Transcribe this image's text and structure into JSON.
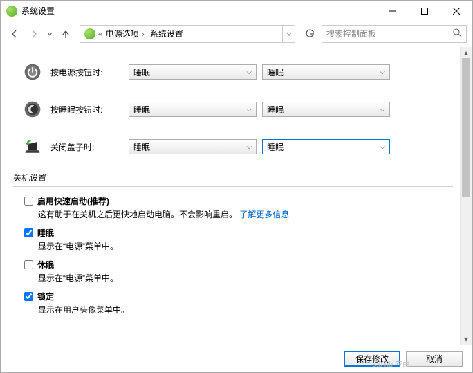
{
  "window": {
    "title": "系统设置"
  },
  "breadcrumb": {
    "sep": "«",
    "items": [
      "电源选项",
      "系统设置"
    ]
  },
  "search": {
    "placeholder": "搜索控制面板"
  },
  "rows": {
    "power_button": {
      "label": "按电源按钮时:",
      "val1": "睡眠",
      "val2": "睡眠"
    },
    "sleep_button": {
      "label": "按睡眠按钮时:",
      "val1": "睡眠",
      "val2": "睡眠"
    },
    "close_lid": {
      "label": "关闭盖子时:",
      "val1": "睡眠",
      "val2": "睡眠"
    }
  },
  "shutdown": {
    "section": "关机设置",
    "fast_start": {
      "label": "启用快速启动(推荐)",
      "checked": false,
      "desc_a": "这有助于在关机之后更快地启动电脑。不会影响重启。",
      "link": "了解更多信息"
    },
    "sleep": {
      "label": "睡眠",
      "checked": true,
      "desc": "显示在“电源”菜单中。"
    },
    "hibernate": {
      "label": "休眠",
      "checked": false,
      "desc": "显示在“电源”菜单中。"
    },
    "lock": {
      "label": "锁定",
      "checked": true,
      "desc": "显示在用户头像菜单中。"
    }
  },
  "footer": {
    "save": "保存修改",
    "cancel": "取消"
  },
  "watermark": "s.c hb 应由"
}
